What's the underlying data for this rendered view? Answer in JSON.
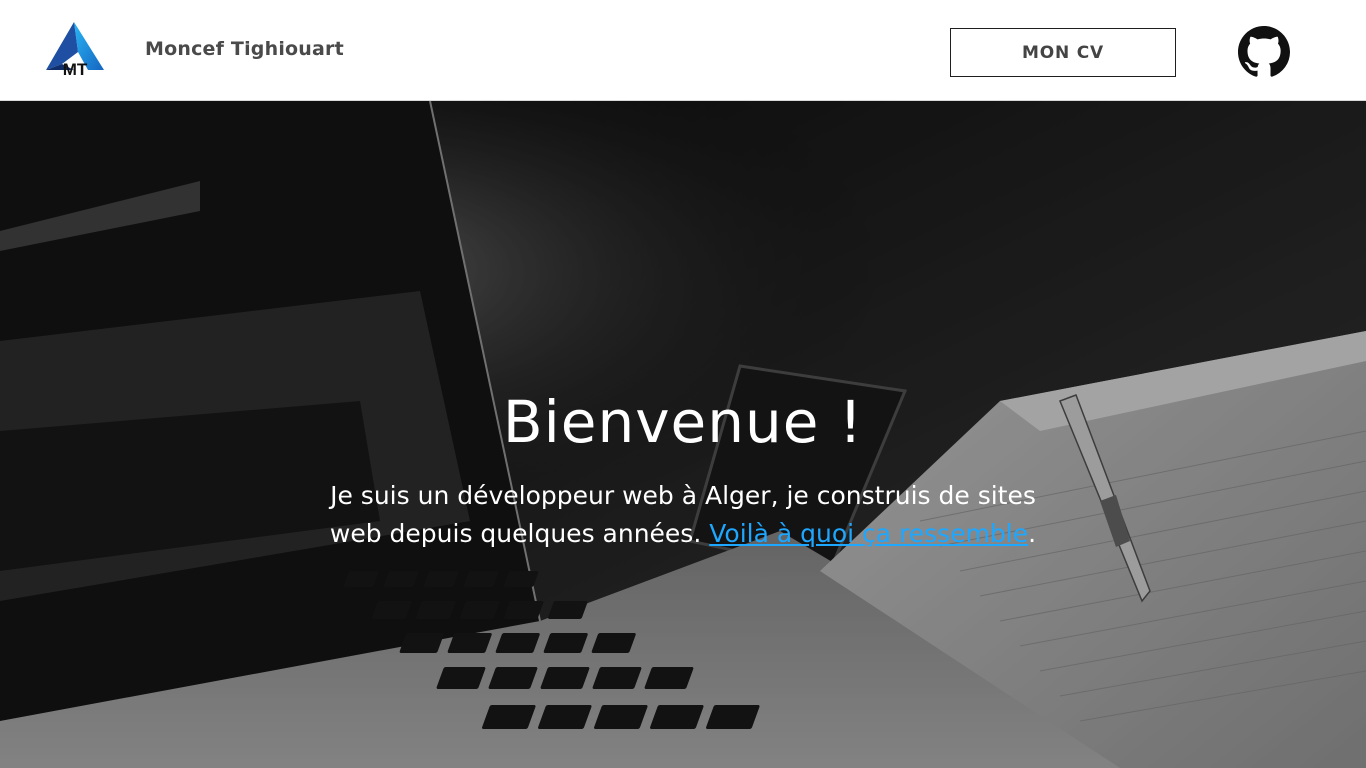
{
  "header": {
    "logo_text": "MT",
    "brand_name": "Moncef Tighiouart",
    "cv_button": "MON CV",
    "github_icon": "github-icon"
  },
  "hero": {
    "title": "Bienvenue !",
    "text_before_link": "Je suis un développeur web à Alger, je construis de sites web depuis quelques années. ",
    "link_text": "Voilà à quoi ça ressemble",
    "text_after_link": ".",
    "background": "laptop-desk-photo"
  },
  "colors": {
    "accent": "#1ea7ff",
    "logo_blue": "#1d9bf0",
    "logo_dark": "#1a3a8f",
    "header_bg": "#ffffff",
    "brand_text": "#4a4a4a"
  }
}
